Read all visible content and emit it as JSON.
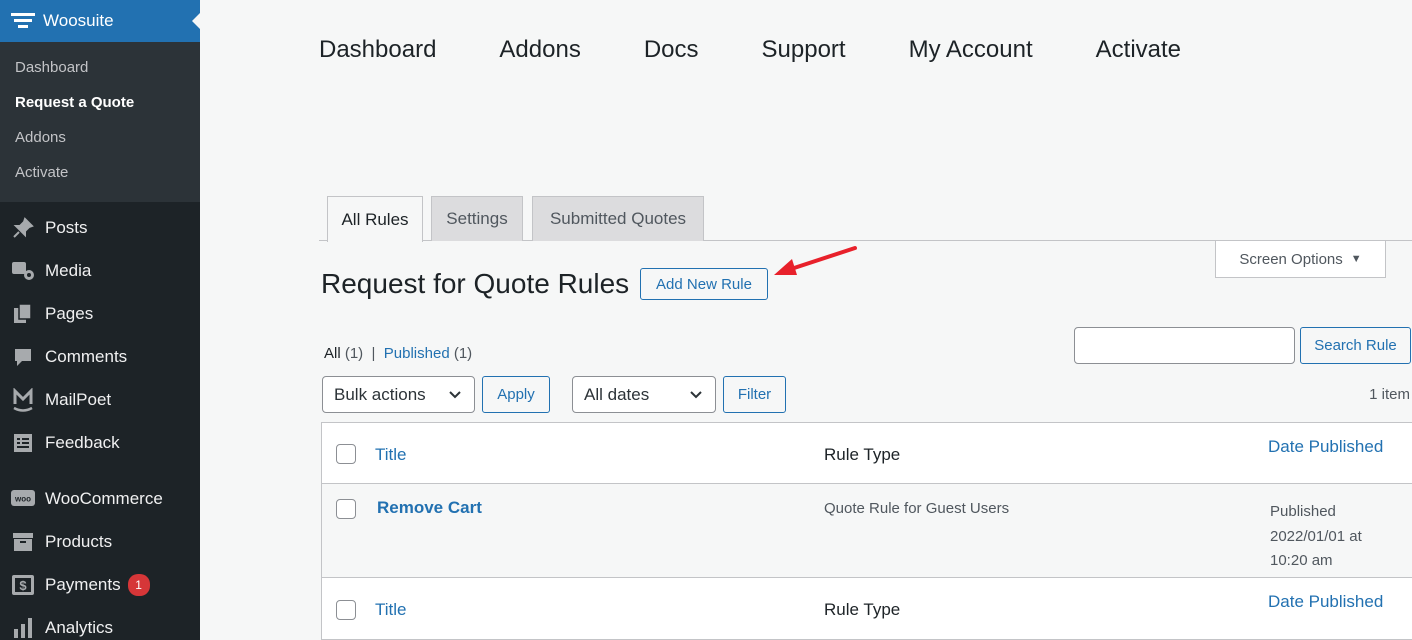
{
  "sidebar": {
    "brand": "Woosuite",
    "submenu": [
      "Dashboard",
      "Request a Quote",
      "Addons",
      "Activate"
    ],
    "menu": [
      {
        "label": "Posts",
        "icon": "pin-icon"
      },
      {
        "label": "Media",
        "icon": "media-icon"
      },
      {
        "label": "Pages",
        "icon": "pages-icon"
      },
      {
        "label": "Comments",
        "icon": "comments-icon"
      },
      {
        "label": "MailPoet",
        "icon": "mailpoet-icon"
      },
      {
        "label": "Feedback",
        "icon": "feedback-icon"
      },
      {
        "label": "WooCommerce",
        "icon": "woo-icon"
      },
      {
        "label": "Products",
        "icon": "products-icon"
      },
      {
        "label": "Payments",
        "icon": "payments-icon",
        "badge": "1"
      },
      {
        "label": "Analytics",
        "icon": "analytics-icon"
      }
    ]
  },
  "topnav": [
    "Dashboard",
    "Addons",
    "Docs",
    "Support",
    "My Account",
    "Activate"
  ],
  "tabs": [
    "All Rules",
    "Settings",
    "Submitted Quotes"
  ],
  "screen_options": "Screen Options",
  "page_title": "Request for Quote Rules",
  "add_new": "Add New Rule",
  "filters": {
    "all_label": "All",
    "all_count": "(1)",
    "sep": "|",
    "published_label": "Published",
    "published_count": "(1)"
  },
  "search_button": "Search Rule",
  "bulk": {
    "selected": "Bulk actions",
    "apply": "Apply"
  },
  "dates": {
    "selected": "All dates",
    "filter": "Filter"
  },
  "item_count": "1 item",
  "table": {
    "columns": [
      "Title",
      "Rule Type",
      "Date Published"
    ],
    "rows": [
      {
        "title": "Remove Cart",
        "rule_type": "Quote Rule for Guest Users",
        "status": "Published",
        "date": "2022/01/01 at",
        "time": "10:20 am"
      }
    ]
  },
  "colors": {
    "accent": "#2271b1",
    "sidebar": "#1d2327",
    "badge": "#d63638",
    "arrow": "#e8212b"
  }
}
